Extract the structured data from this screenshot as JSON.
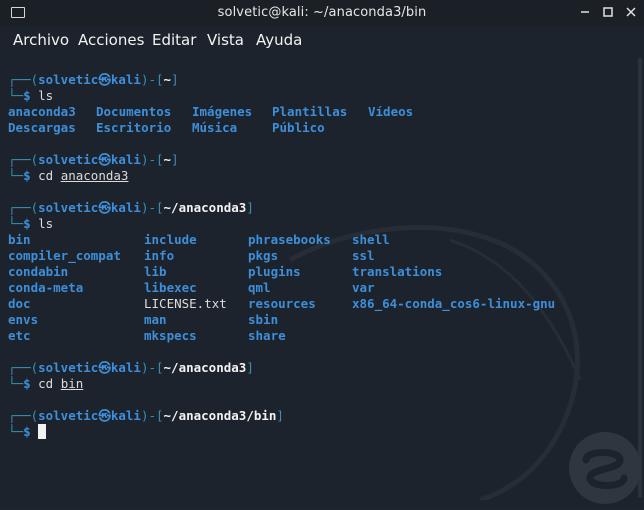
{
  "window": {
    "title": "solvetic@kali: ~/anaconda3/bin"
  },
  "menu": {
    "items": [
      "Archivo",
      "Acciones",
      "Editar",
      "Vista",
      "Ayuda"
    ]
  },
  "prompts": [
    {
      "user": "solvetic",
      "host": "kali",
      "path": "~",
      "command": "ls",
      "arg": ""
    },
    {
      "user": "solvetic",
      "host": "kali",
      "path": "~",
      "command": "cd ",
      "arg": "anaconda3"
    },
    {
      "user": "solvetic",
      "host": "kali",
      "path": "~/anaconda3",
      "command": "ls",
      "arg": ""
    },
    {
      "user": "solvetic",
      "host": "kali",
      "path": "~/anaconda3",
      "command": "cd ",
      "arg": "bin"
    },
    {
      "user": "solvetic",
      "host": "kali",
      "path": "~/anaconda3/bin",
      "command": "",
      "arg": ""
    }
  ],
  "symbols": {
    "at": "㉿",
    "dollar": "$"
  },
  "home_listing": {
    "row1": [
      "anaconda3",
      "Documentos",
      "Imágenes",
      "Plantillas",
      "Vídeos"
    ],
    "row2": [
      "Descargas",
      "Escritorio",
      "Música",
      "Público"
    ]
  },
  "anaconda_listing": {
    "col1": [
      "bin",
      "compiler_compat",
      "condabin",
      "conda-meta",
      "doc",
      "envs",
      "etc"
    ],
    "col2": [
      "include",
      "info",
      "lib",
      "libexec",
      "LICENSE.txt",
      "man",
      "mkspecs"
    ],
    "col3": [
      "phrasebooks",
      "pkgs",
      "plugins",
      "qml",
      "resources",
      "sbin",
      "share"
    ],
    "col4": [
      "shell",
      "ssl",
      "translations",
      "var",
      "x86_64-conda_cos6-linux-gnu"
    ]
  },
  "colors": {
    "prompt": "#3d8fb0",
    "directory": "#3d8fda",
    "text": "#f2f2f2",
    "background": "#1d232c"
  }
}
